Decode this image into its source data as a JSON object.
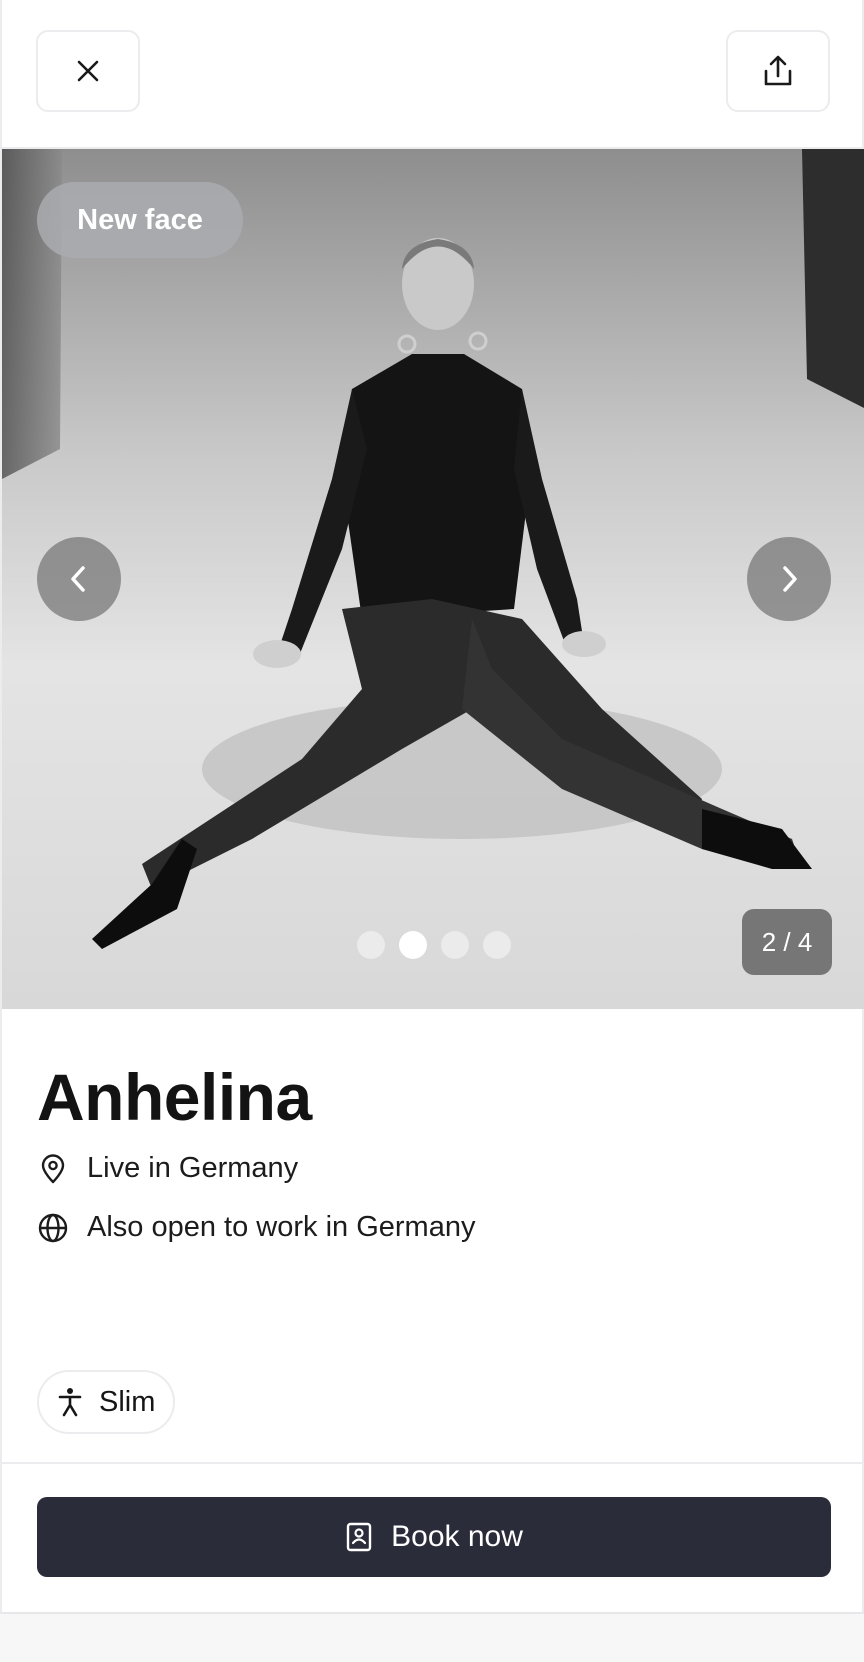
{
  "header": {
    "close_icon": "close-icon",
    "share_icon": "share-icon"
  },
  "gallery": {
    "badge": "New face",
    "counter": "2 / 4",
    "current_index": 2,
    "total": 4,
    "prev_icon": "chevron-left-icon",
    "next_icon": "chevron-right-icon"
  },
  "profile": {
    "name": "Anhelina",
    "location": "Live in Germany",
    "open_to_work": "Also open to work in Germany",
    "location_icon": "map-pin-icon",
    "globe_icon": "globe-icon",
    "tags": [
      {
        "label": "Slim",
        "icon": "body-type-icon"
      }
    ]
  },
  "footer": {
    "book_label": "Book now",
    "book_icon": "contact-book-icon",
    "button_color": "#2a2c3a"
  }
}
